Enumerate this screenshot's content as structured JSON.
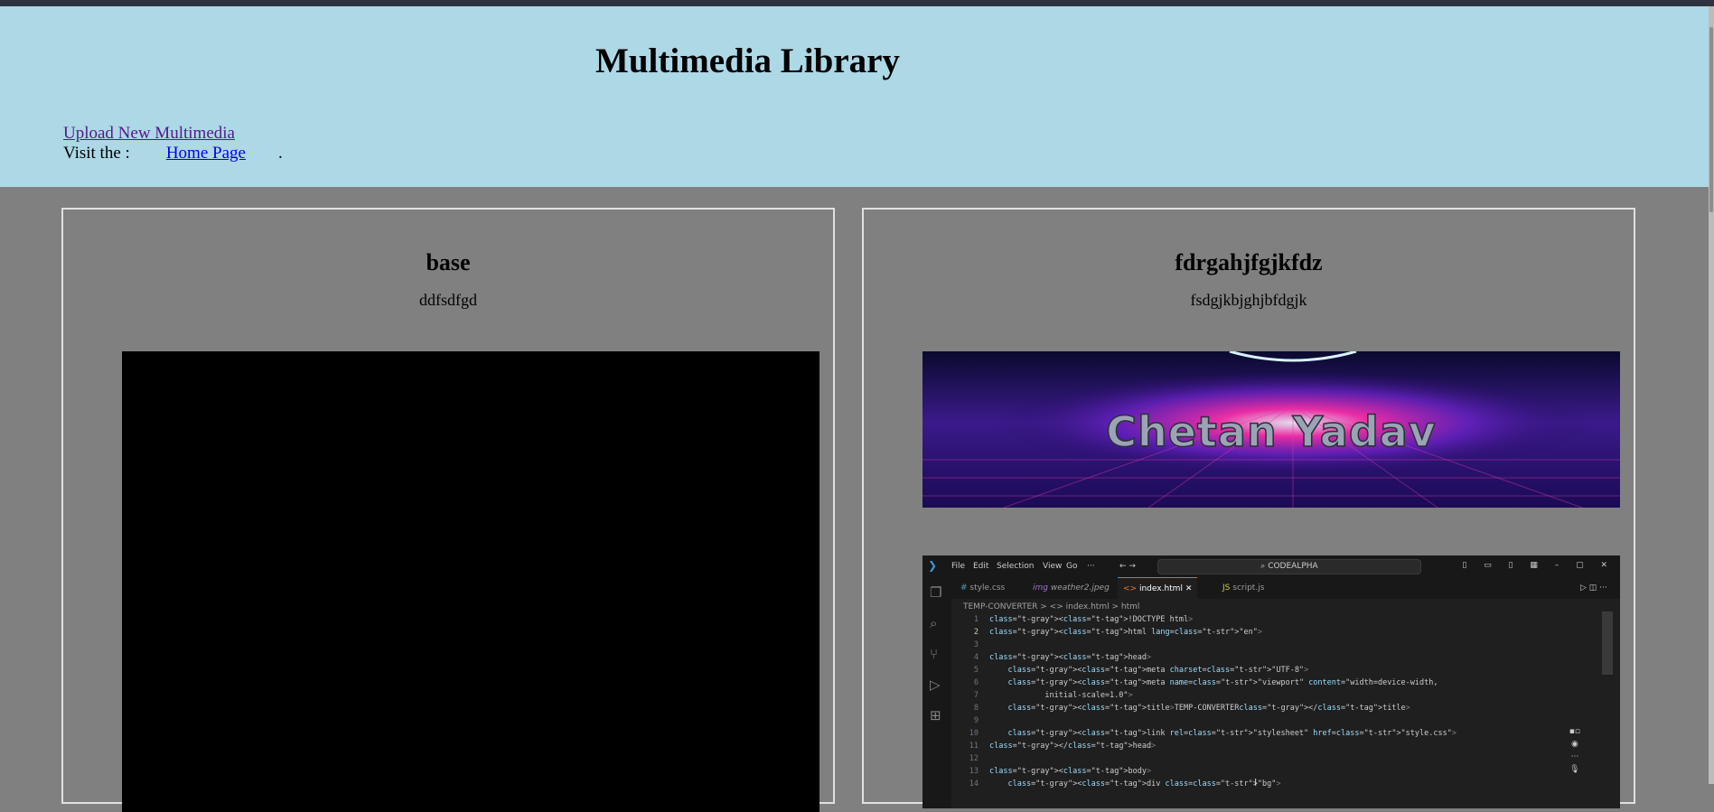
{
  "header": {
    "title": "Multimedia Library",
    "upload_link": "Upload New Multimedia",
    "visit_prefix": "Visit the :",
    "home_link": "Home Page",
    "visit_suffix": "."
  },
  "cards": [
    {
      "title": "base",
      "description": "ddfsdfgd",
      "media": "video"
    },
    {
      "title": "fdrgahjfgjkfdz",
      "description": "fsdgjkbjghjbfdgjk",
      "media": "images"
    }
  ],
  "banner": {
    "text": "Chetan Yadav",
    "colors": {
      "top": "#0a0a2e",
      "mid": "#6d22c9",
      "glow": "#ff2fa8",
      "bottom": "#1b0a55"
    }
  },
  "editor": {
    "menu": [
      "File",
      "Edit",
      "Selection",
      "View",
      "Go",
      "···"
    ],
    "search": "CODEALPHA",
    "tabs": [
      "style.css",
      "weather2.jpeg",
      "index.html",
      "script.js"
    ],
    "tab_icons": [
      "#",
      "img",
      "<>",
      "JS"
    ],
    "active_tab": "index.html",
    "breadcrumb": "TEMP-CONVERTER > <> index.html > html",
    "code_lines": [
      {
        "n": "1",
        "c": "<!DOCTYPE html>"
      },
      {
        "n": "2",
        "c": "<html lang=\"en\">"
      },
      {
        "n": "3",
        "c": ""
      },
      {
        "n": "4",
        "c": "<head>"
      },
      {
        "n": "5",
        "c": "    <meta charset=\"UTF-8\">"
      },
      {
        "n": "6",
        "c": "    <meta name=\"viewport\" content=\"width=device-width,"
      },
      {
        "n": "7",
        "c": "            initial-scale=1.0\">"
      },
      {
        "n": "8",
        "c": "    <title>TEMP-CONVERTER</title>"
      },
      {
        "n": "9",
        "c": ""
      },
      {
        "n": "10",
        "c": "    <link rel=\"stylesheet\" href=\"style.css\">"
      },
      {
        "n": "11",
        "c": "</head>"
      },
      {
        "n": "12",
        "c": ""
      },
      {
        "n": "13",
        "c": "<body>"
      },
      {
        "n": "14",
        "c": "    <div class=\"bg\">"
      }
    ],
    "colors": {
      "bg": "#1f1f1f",
      "accent": "#3a96dd",
      "tag": "#569cd6",
      "attr": "#9cdcfe",
      "string": "#ce9178"
    }
  },
  "colors": {
    "header_bg": "#add8e6",
    "page_bg": "#808080",
    "card_border": "#e0e0e0"
  }
}
